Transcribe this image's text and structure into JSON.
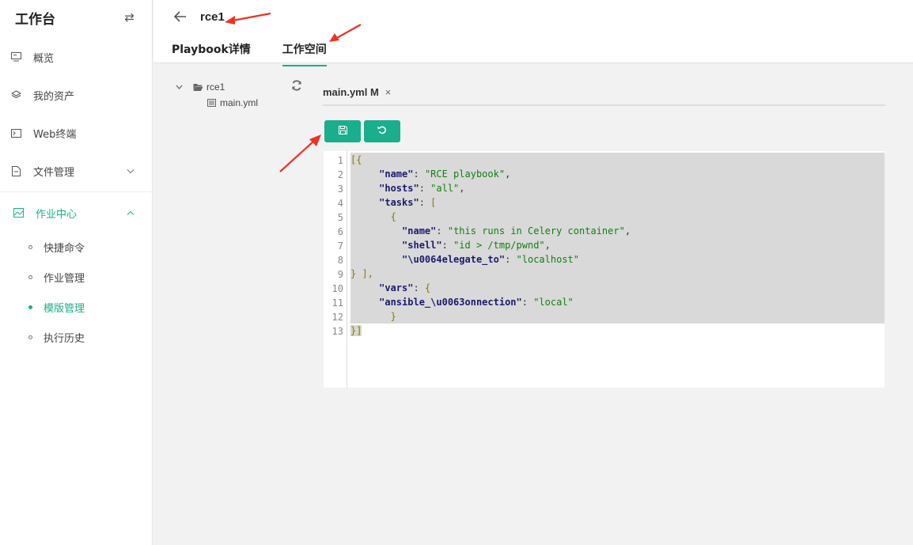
{
  "sidebar": {
    "title": "工作台",
    "items": [
      {
        "label": "概览"
      },
      {
        "label": "我的资产"
      },
      {
        "label": "Web终端"
      },
      {
        "label": "文件管理"
      },
      {
        "label": "作业中心"
      }
    ],
    "subitems": [
      {
        "label": "快捷命令"
      },
      {
        "label": "作业管理"
      },
      {
        "label": "模版管理"
      },
      {
        "label": "执行历史"
      }
    ],
    "active_sub": "模版管理"
  },
  "header": {
    "title": "rce1",
    "tabs": [
      {
        "label": "Playbook详情"
      },
      {
        "label": "工作空间"
      }
    ],
    "active_tab": "工作空间"
  },
  "tree": {
    "folder": "rce1",
    "file": "main.yml"
  },
  "editor": {
    "tab_label": "main.yml M",
    "close_glyph": "×",
    "line_numbers": [
      "1",
      "2",
      "3",
      "4",
      "5",
      "6",
      "7",
      "8",
      "9",
      "10",
      "11",
      "12",
      "13"
    ]
  },
  "colors": {
    "accent": "#1aae8c",
    "annotation": "#ee3322"
  }
}
